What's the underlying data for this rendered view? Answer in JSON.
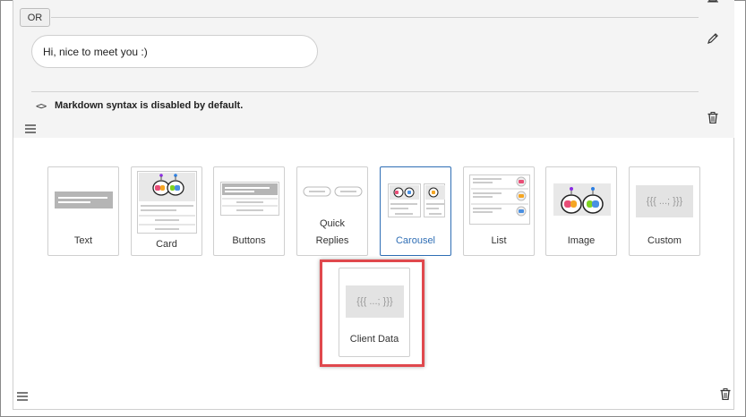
{
  "top": {
    "or_label": "OR",
    "greeting": "Hi, nice to meet you :)",
    "code_symbol": "<>",
    "markdown_note": "Markdown syntax is disabled by default."
  },
  "palette": {
    "tiles": [
      {
        "label": "Text",
        "icon": "text-preview"
      },
      {
        "label": "Card",
        "icon": "card-preview"
      },
      {
        "label": "Buttons",
        "icon": "buttons-preview"
      },
      {
        "label": "Quick",
        "label_line2": "Replies",
        "icon": "quick-replies-preview"
      },
      {
        "label": "Carousel",
        "icon": "carousel-preview",
        "selected": true
      },
      {
        "label": "List",
        "icon": "list-preview"
      },
      {
        "label": "Image",
        "icon": "image-preview"
      },
      {
        "label": "Custom",
        "icon": "custom-preview",
        "glyph": "{{{ ...; }}}"
      }
    ],
    "client_data": {
      "label": "Client Data",
      "glyph": "{{{ ...; }}}"
    }
  },
  "colors": {
    "accent": "#2f6eb5",
    "highlight": "#e0484d",
    "panel_bg": "#f4f4f4"
  }
}
